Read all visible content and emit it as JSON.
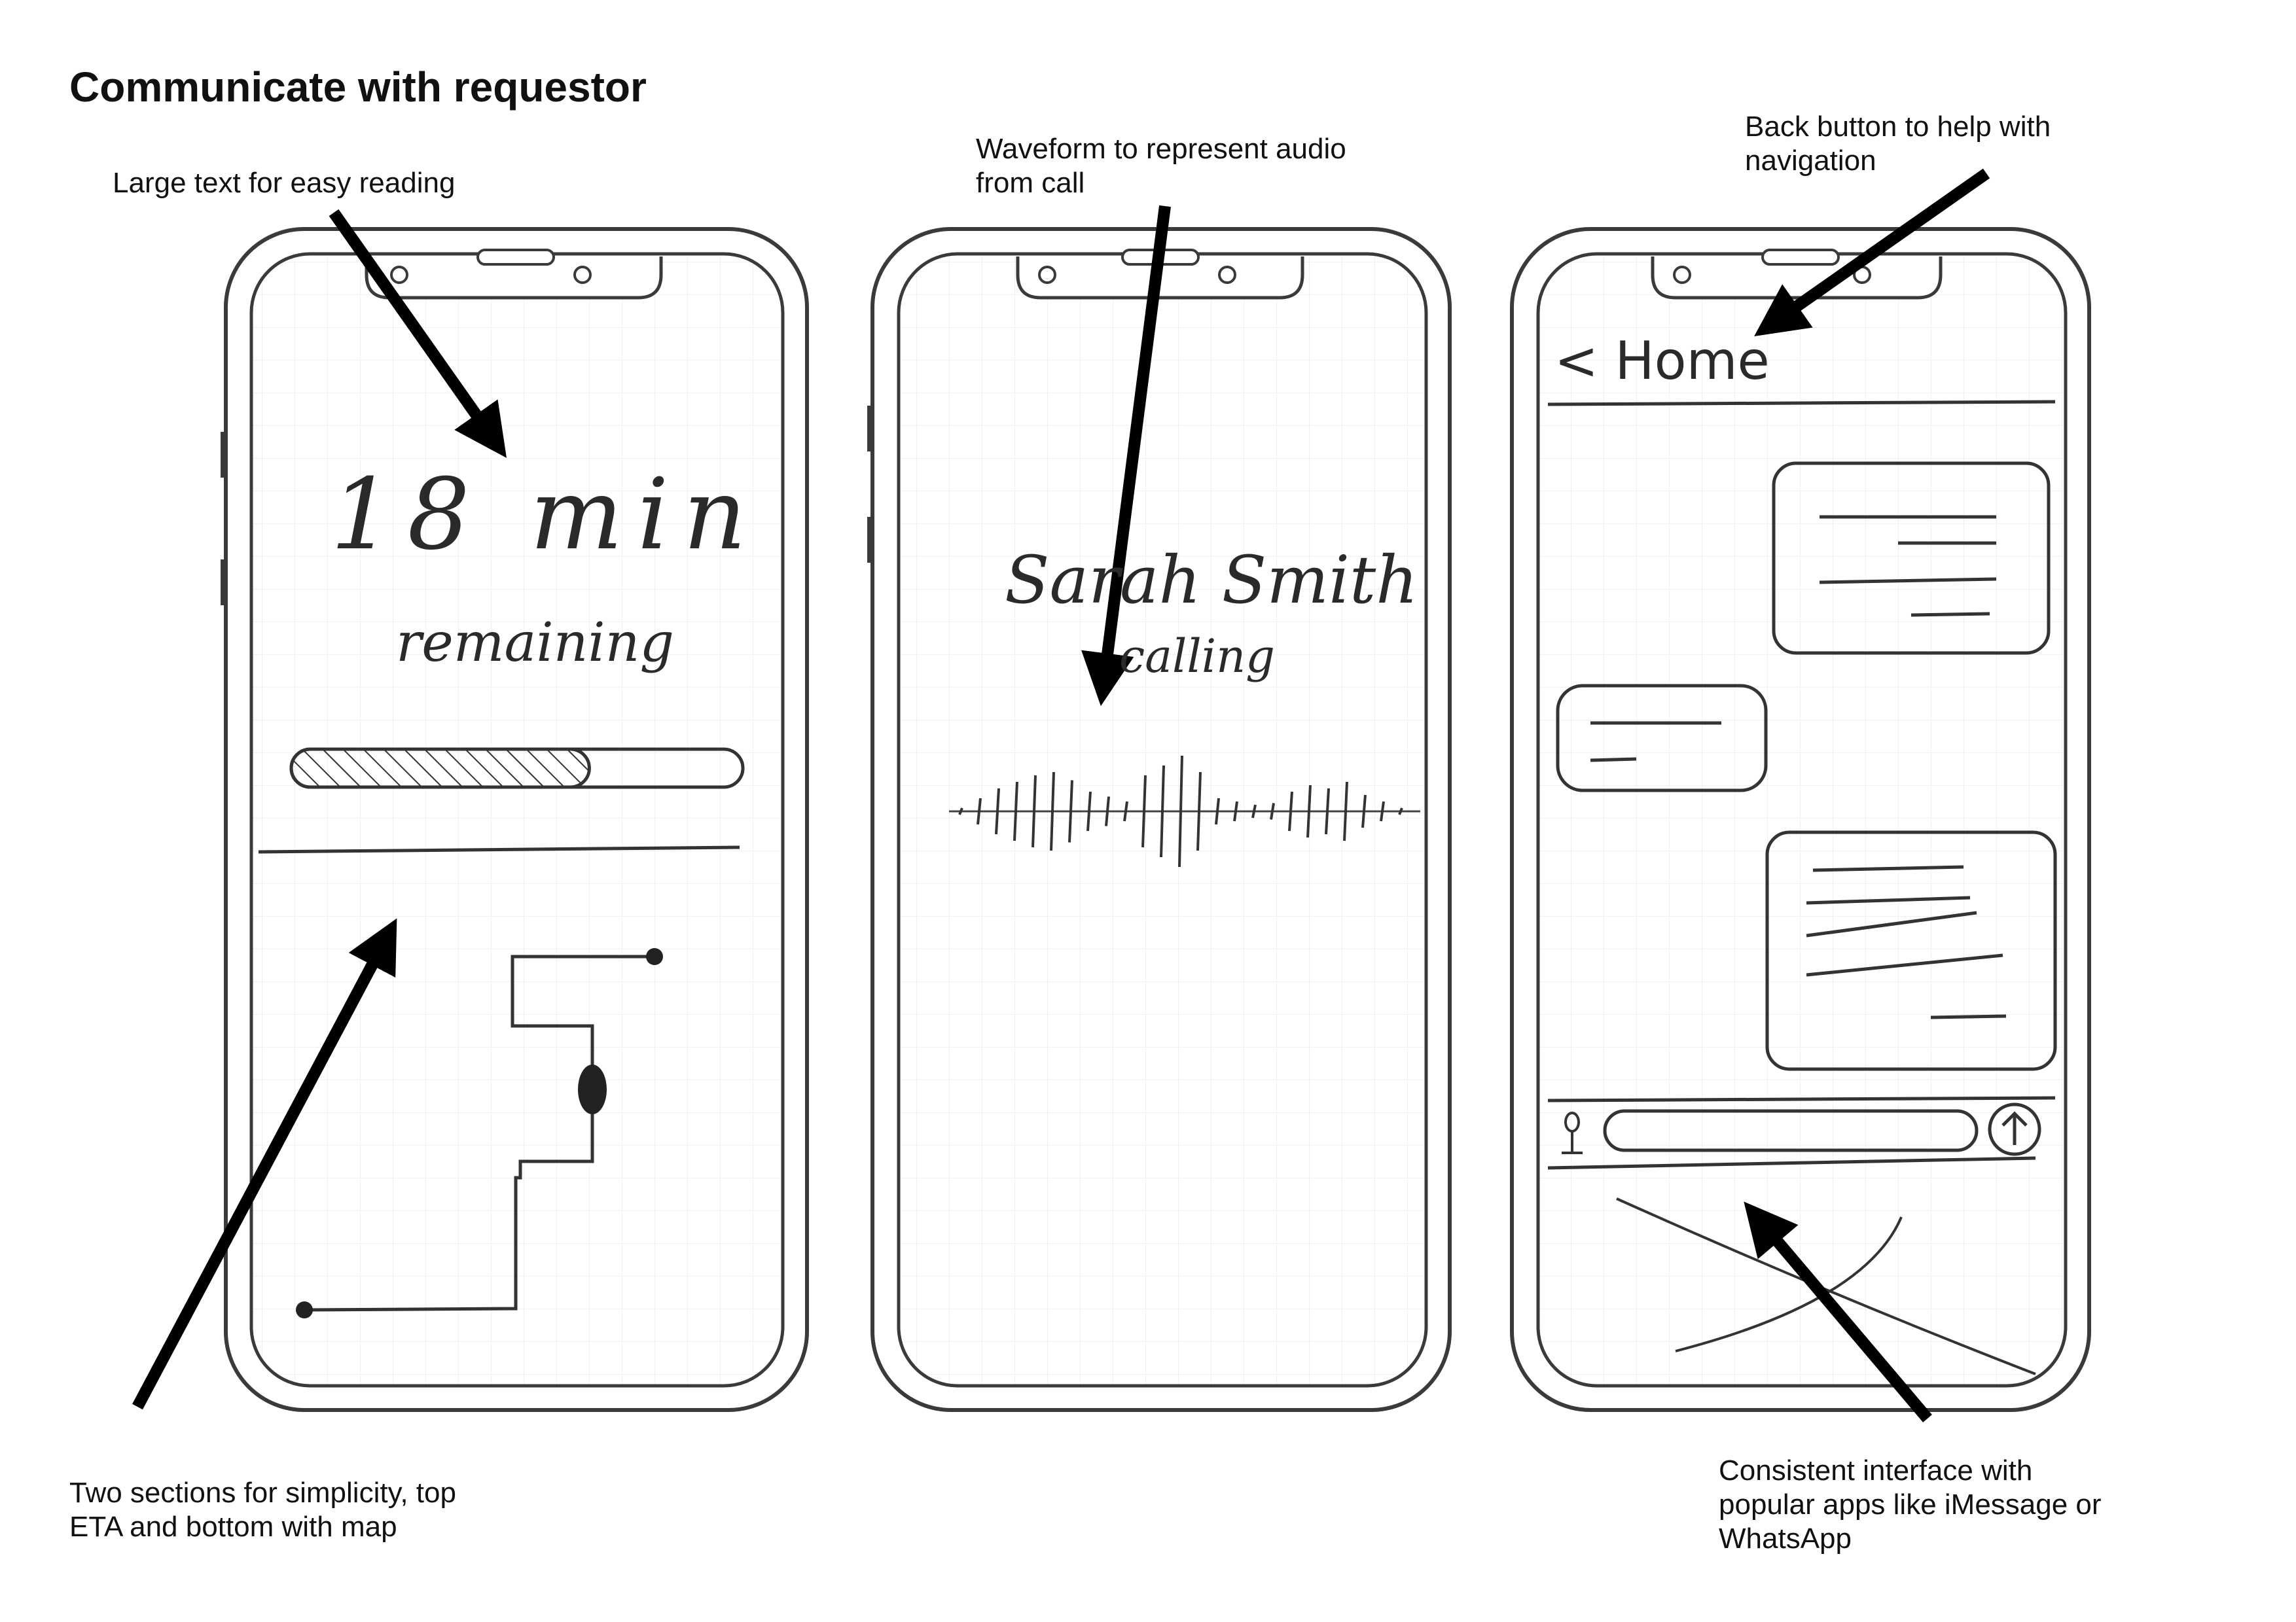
{
  "title": "Communicate with requestor",
  "notes": {
    "large_text": "Large text for easy reading",
    "waveform": "Waveform to represent audio\nfrom call",
    "back_button": "Back button to help with\nnavigation",
    "two_sections": "Two sections for simplicity, top\nETA and bottom with map",
    "consistent": "Consistent interface with\npopular apps like iMessage or\nWhatsApp"
  },
  "eta_screen": {
    "minutes": "18 min",
    "status": "remaining",
    "progress_fraction": 0.66
  },
  "call_screen": {
    "caller": "Sarah Smith",
    "status": "calling"
  },
  "chat_screen": {
    "back_label": "< Home"
  },
  "icons": {
    "mic": "mic-icon",
    "send": "send-arrow-icon"
  }
}
